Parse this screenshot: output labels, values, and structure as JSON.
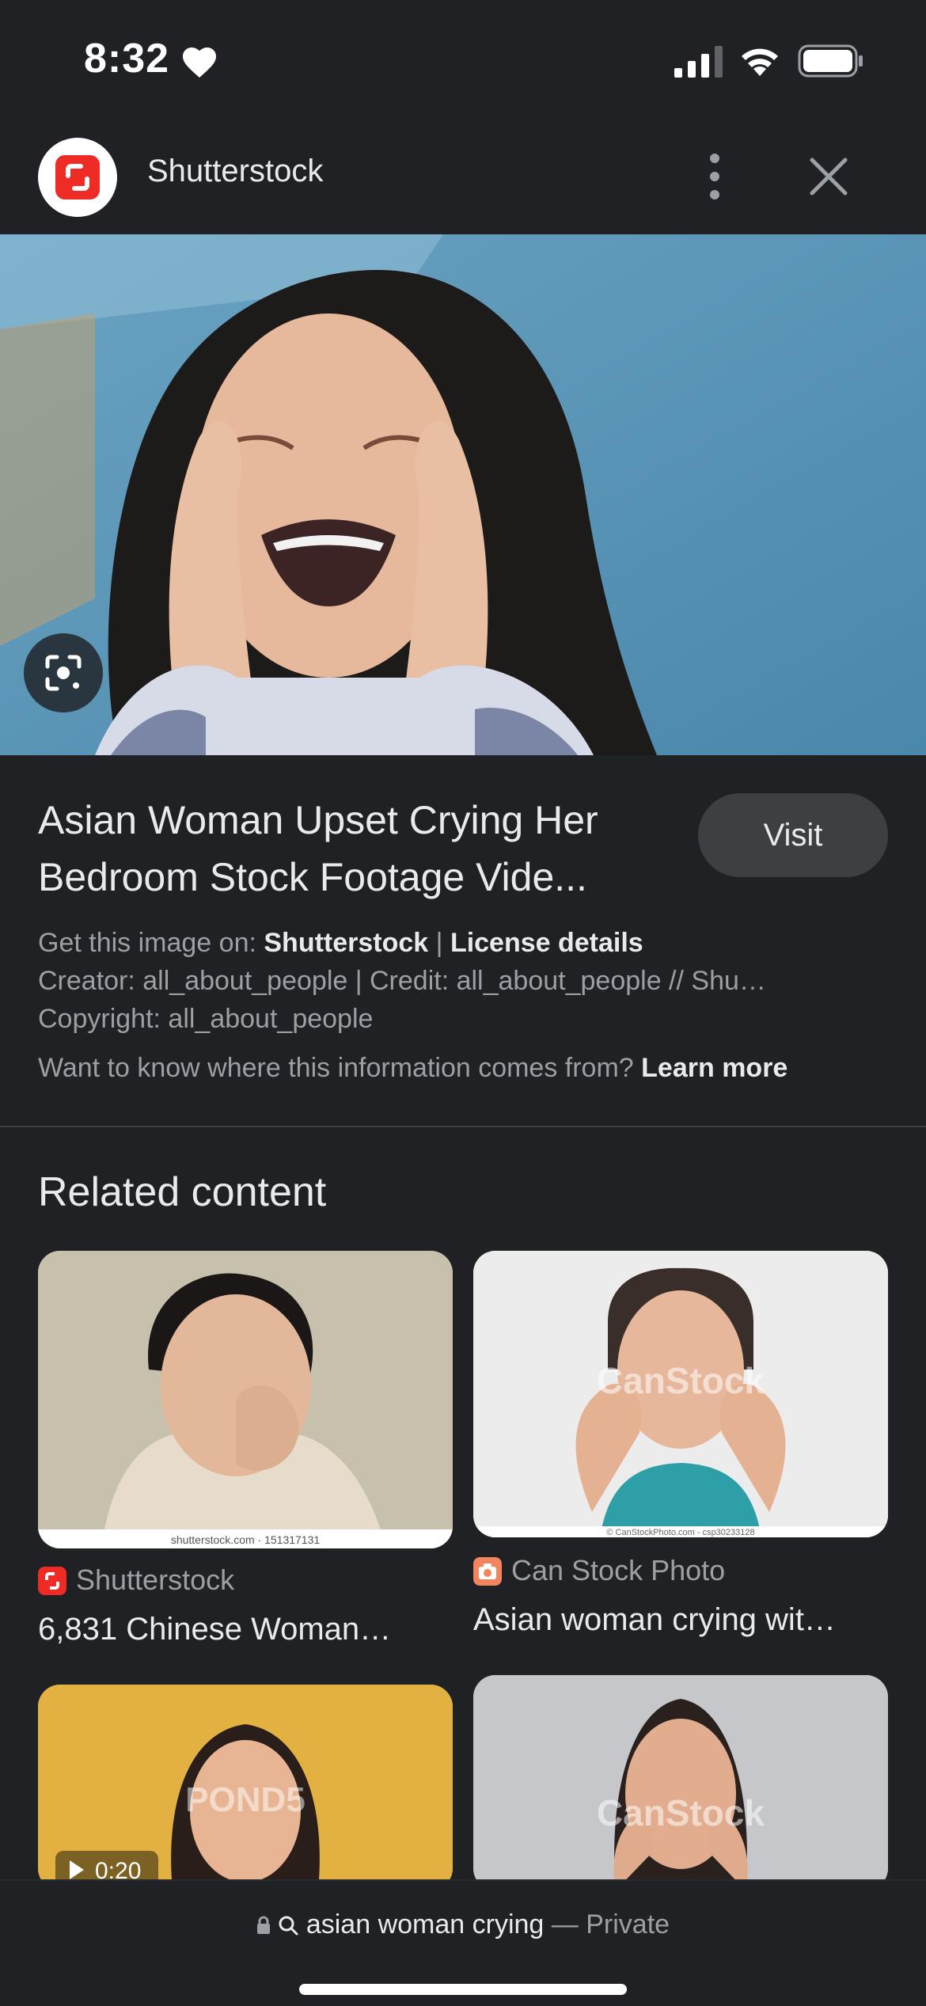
{
  "status": {
    "time": "8:32"
  },
  "header": {
    "site_name": "Shutterstock"
  },
  "result": {
    "title_line1": "Asian Woman Upset Crying Her",
    "title_line2": "Bedroom Stock Footage Vide...",
    "visit_label": "Visit",
    "get_image_prefix": "Get this image on: ",
    "get_image_site": "Shutterstock",
    "separator": " | ",
    "license_details": "License details",
    "creator_line": "Creator: all_about_people | Credit: all_about_people // Shu…",
    "copyright_line": "Copyright: all_about_people",
    "info_question": "Want to know where this information comes from? ",
    "learn_more": "Learn more"
  },
  "related": {
    "title": "Related content",
    "cards": [
      {
        "source": "Shutterstock",
        "caption": "6,831 Chinese Woman…",
        "watermark": "shutterstock.com · 151317131"
      },
      {
        "source": "Can Stock Photo",
        "caption": "Asian woman crying wit…",
        "watermark": "CanStock",
        "footer": "© CanStockPhoto.com - csp30233128"
      },
      {
        "watermark": "POND5",
        "duration": "0:20"
      },
      {
        "watermark": "CanStock"
      }
    ]
  },
  "bottom": {
    "query": "asian woman crying",
    "private_label": "— Private"
  },
  "colors": {
    "background": "#202124",
    "text": "#e8eaed",
    "muted": "#9aa0a6",
    "visit_bg": "#3c4043",
    "shutterstock_red": "#ee2b24",
    "canstock_orange": "#f2855f"
  },
  "icons": [
    "heart-icon",
    "signal-icon",
    "wifi-icon",
    "battery-icon",
    "shutterstock-logo",
    "more-vert-icon",
    "close-icon",
    "google-lens-icon",
    "lock-icon",
    "search-icon",
    "play-icon"
  ]
}
